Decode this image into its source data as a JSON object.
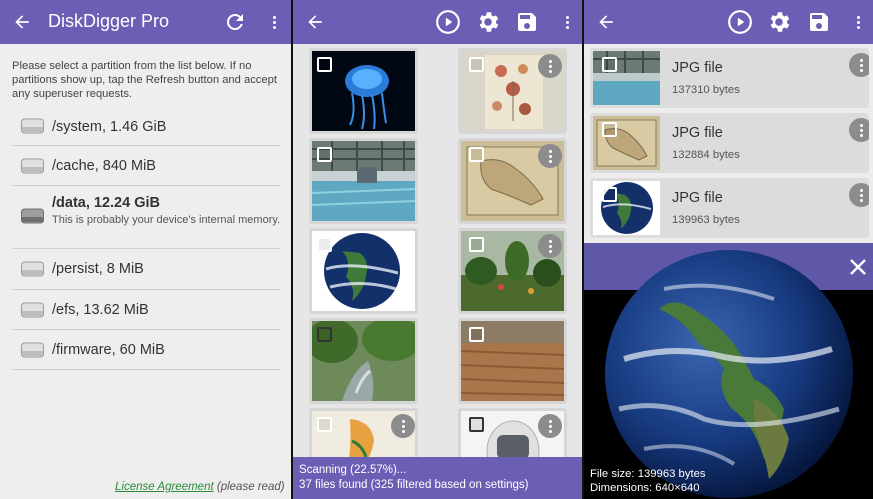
{
  "colors": {
    "appbar": "#6b5fb5",
    "license_link": "#2d8a3b",
    "scan_bar": "#6b5fb5"
  },
  "panel1": {
    "title": "DiskDigger Pro",
    "back_icon": "arrow-left-icon",
    "refresh_icon": "refresh-icon",
    "menu_icon": "overflow-menu-icon",
    "intro": "Please select a partition from the list below. If no partitions show up, tap the Refresh button and accept any superuser requests.",
    "partitions": [
      {
        "name": "/system, 1.46 GiB",
        "desc": ""
      },
      {
        "name": "/cache, 840 MiB",
        "desc": ""
      },
      {
        "name": "/data, 12.24 GiB",
        "desc": "This is probably your device's internal memory."
      },
      {
        "name": "/persist, 8 MiB",
        "desc": ""
      },
      {
        "name": "/efs, 13.62 MiB",
        "desc": ""
      },
      {
        "name": "/firmware, 60 MiB",
        "desc": ""
      }
    ],
    "license_link": "License Agreement",
    "license_note": "(please read)"
  },
  "panel2": {
    "icons": [
      "arrow-left-icon",
      "play-icon",
      "settings-icon",
      "save-icon",
      "overflow-menu-icon"
    ],
    "thumbnails": [
      "jellyfish",
      "botanical illustration",
      "indoor pool",
      "antique map",
      "earth",
      "jungle plants",
      "river in forest",
      "field",
      "map of lebanon",
      "astronaut helmet"
    ],
    "scan_status": "Scanning (22.57%)...",
    "files_found": "37 files found (325 filtered based on settings)",
    "scan_progress": 0.2257
  },
  "panel3": {
    "icons": [
      "arrow-left-icon",
      "play-icon",
      "settings-icon",
      "save-icon",
      "overflow-menu-icon"
    ],
    "files": [
      {
        "type": "JPG file",
        "size": "137310 bytes"
      },
      {
        "type": "JPG file",
        "size": "132884 bytes"
      },
      {
        "type": "JPG file",
        "size": "139963 bytes"
      }
    ],
    "preview": {
      "close_icon": "close-icon",
      "file_size": "File size: 139963 bytes",
      "dimensions": "Dimensions: 640×640"
    }
  }
}
